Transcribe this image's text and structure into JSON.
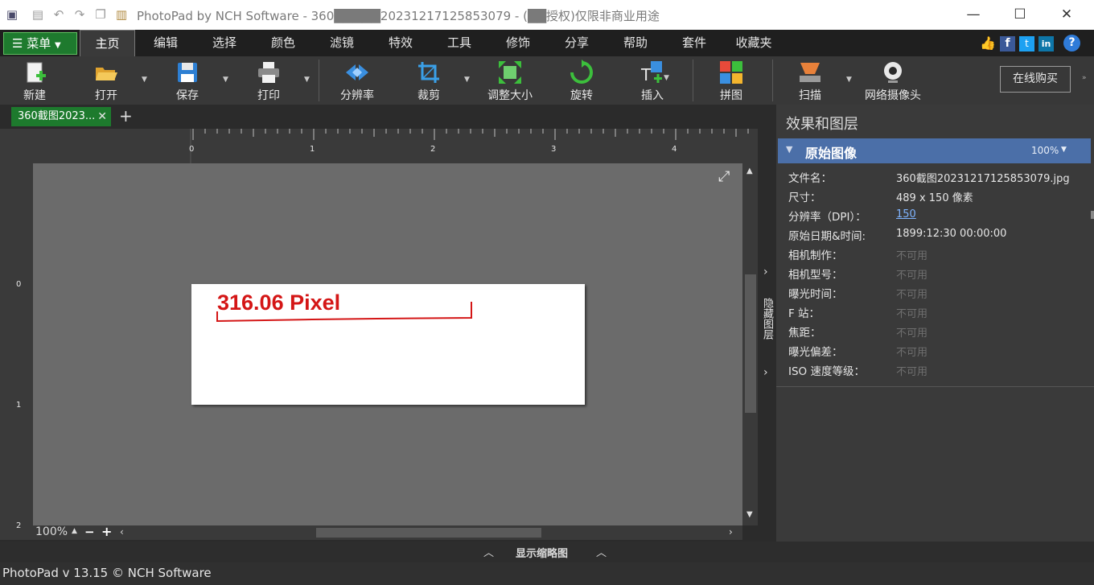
{
  "window": {
    "title": "PhotoPad by NCH Software - 360█████2023121712585307 9 - (██授权)仅限非商业用途",
    "title_display": "PhotoPad by NCH Software - 360█████20231217125853079 - (██授权)仅限非商业用途",
    "minimize": "—",
    "maximize": "☐",
    "close": "✕"
  },
  "menubar": {
    "menu_label": "菜单",
    "tabs": [
      "主页",
      "编辑",
      "选择",
      "颜色",
      "滤镜",
      "特效",
      "工具",
      "修饰",
      "分享",
      "帮助",
      "套件",
      "收藏夹"
    ],
    "help_icon": "?"
  },
  "toolbar": {
    "new": "新建",
    "open": "打开",
    "save": "保存",
    "print": "打印",
    "resolution": "分辨率",
    "crop": "裁剪",
    "resize": "调整大小",
    "rotate": "旋转",
    "insert": "插入",
    "collage": "拼图",
    "scan": "扫描",
    "webcam": "网络摄像头",
    "buy_online": "在线购买"
  },
  "document": {
    "tab_label": "360截图2023...",
    "tab_close": "✕",
    "add_tab": "+",
    "image_text": "316.06 Pixel"
  },
  "rulers": {
    "top": [
      "0",
      "1",
      "2",
      "3",
      "4"
    ],
    "left": [
      "0",
      "1",
      "2"
    ]
  },
  "zoom": {
    "level": "100%",
    "minus": "−",
    "plus": "+"
  },
  "thumbnail_bar": {
    "label": "显示缩略图"
  },
  "status": {
    "text": "PhotoPad v 13.15 © NCH Software"
  },
  "sidebar_tab": {
    "label": "隐藏图层"
  },
  "panel": {
    "title": "效果和图层",
    "section": "原始图像",
    "section_zoom": "100%",
    "rows": [
      {
        "label": "文件名：",
        "value": "360截图20231217125853079.jpg"
      },
      {
        "label": "尺寸：",
        "value": "489 x 150 像素"
      },
      {
        "label": "分辨率（DPI）：",
        "value": "150"
      },
      {
        "label": "原始日期&时间:",
        "value": "1899:12:30 00:00:00"
      },
      {
        "label": "相机制作：",
        "value": "不可用"
      },
      {
        "label": "相机型号：",
        "value": "不可用"
      },
      {
        "label": "曝光时间：",
        "value": "不可用"
      },
      {
        "label": "F 站：",
        "value": "不可用"
      },
      {
        "label": "焦距：",
        "value": "不可用"
      },
      {
        "label": "曝光偏差：",
        "value": "不可用"
      },
      {
        "label": "ISO 速度等级：",
        "value": "不可用"
      }
    ]
  },
  "colors": {
    "accent_green": "#1e7a2e",
    "panel_header_blue": "#4b6fa8",
    "image_text_red": "#d41616"
  }
}
